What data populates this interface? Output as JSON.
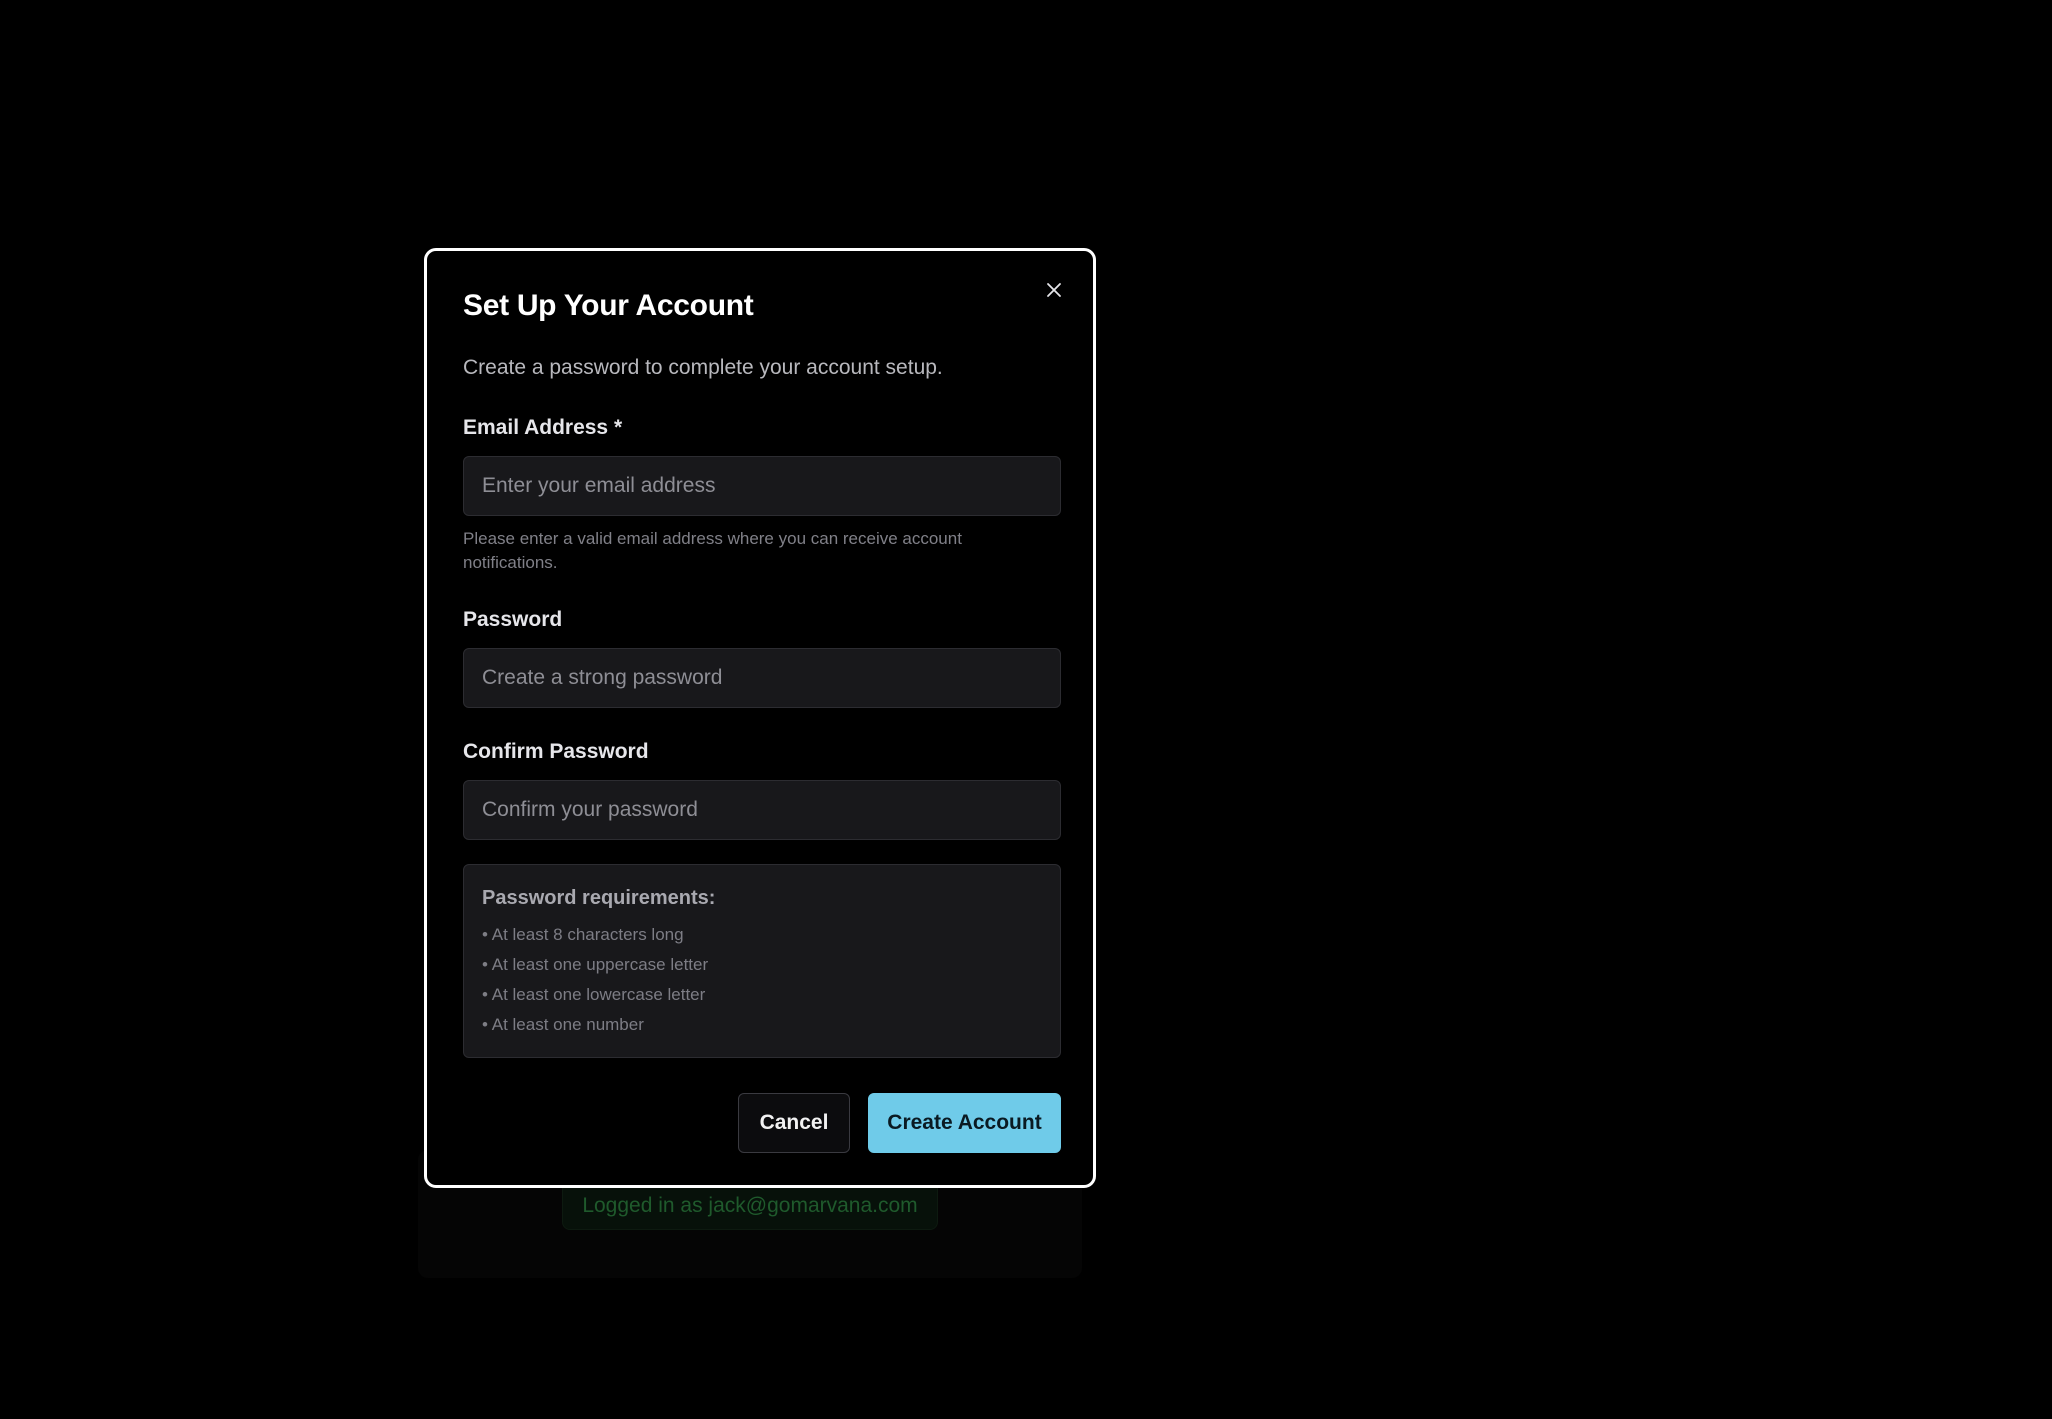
{
  "background": {
    "status_text": "Logged in as jack@gomarvana.com"
  },
  "modal": {
    "title": "Set Up Your Account",
    "description": "Create a password to complete your account setup.",
    "close_icon": "close-icon",
    "email": {
      "label": "Email Address *",
      "placeholder": "Enter your email address",
      "value": "",
      "helper": "Please enter a valid email address where you can receive account notifications."
    },
    "password": {
      "label": "Password",
      "placeholder": "Create a strong password",
      "value": ""
    },
    "confirm_password": {
      "label": "Confirm Password",
      "placeholder": "Confirm your password",
      "value": ""
    },
    "requirements": {
      "title": "Password requirements:",
      "items": [
        "• At least 8 characters long",
        "• At least one uppercase letter",
        "• At least one lowercase letter",
        "• At least one number"
      ]
    },
    "buttons": {
      "cancel": "Cancel",
      "create": "Create Account"
    }
  },
  "colors": {
    "background": "#000000",
    "modal_border": "#ffffff",
    "input_background": "#18181b",
    "primary_button": "#6fcbe9",
    "status_text": "#1f5a2c"
  }
}
